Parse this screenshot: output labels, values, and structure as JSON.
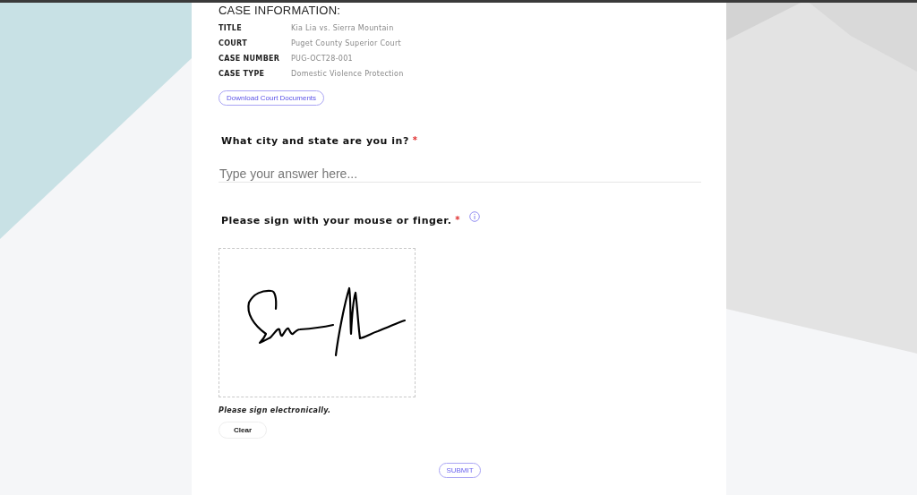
{
  "case_information": {
    "heading": "CASE INFORMATION:",
    "fields": [
      {
        "label": "TITLE",
        "value": "Kia Lia vs. Sierra Mountain"
      },
      {
        "label": "COURT",
        "value": "Puget County Superior Court"
      },
      {
        "label": "CASE NUMBER",
        "value": "PUG-OCT28-001"
      },
      {
        "label": "CASE TYPE",
        "value": "Domestic Violence Protection"
      }
    ],
    "download_button": "Download Court Documents"
  },
  "questions": [
    {
      "kind": "text",
      "label": "What city and state are you in?",
      "required_mark": "*",
      "placeholder": "Type your answer here..."
    },
    {
      "kind": "signature",
      "label": "Please sign with your mouse or finger.",
      "required_mark": "*",
      "info": true,
      "hint": "Please sign electronically.",
      "clear_button": "Clear"
    }
  ],
  "submit_button": "SUBMIT"
}
